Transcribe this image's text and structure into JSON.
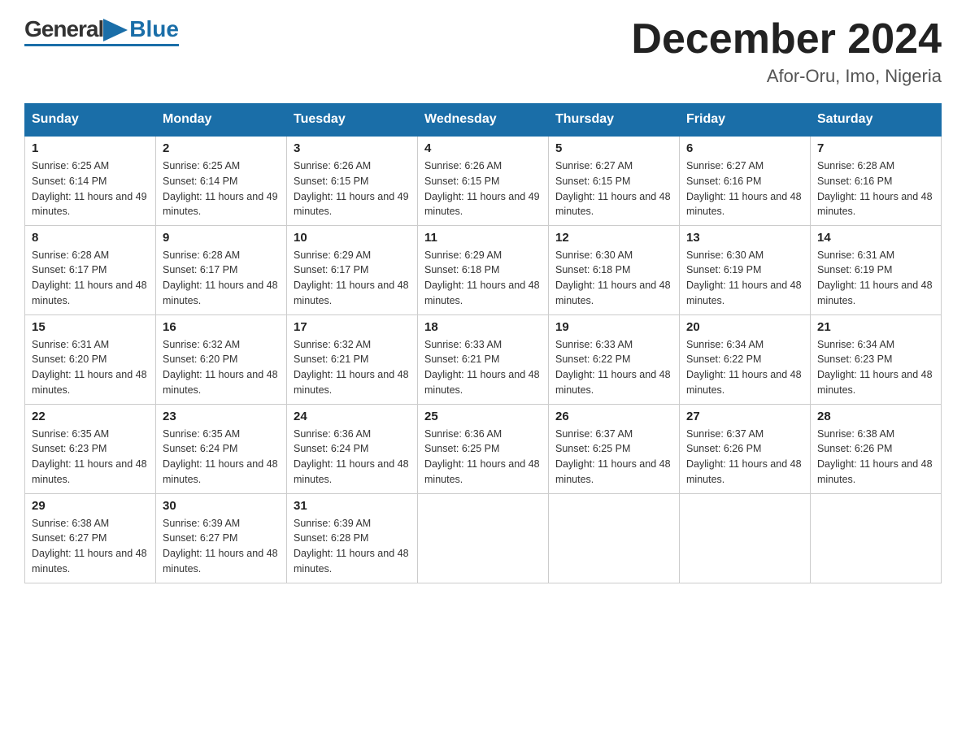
{
  "header": {
    "logo_general": "General",
    "logo_blue": "Blue",
    "month_year": "December 2024",
    "location": "Afor-Oru, Imo, Nigeria"
  },
  "weekdays": [
    "Sunday",
    "Monday",
    "Tuesday",
    "Wednesday",
    "Thursday",
    "Friday",
    "Saturday"
  ],
  "weeks": [
    [
      {
        "day": "1",
        "sunrise": "6:25 AM",
        "sunset": "6:14 PM",
        "daylight": "11 hours and 49 minutes."
      },
      {
        "day": "2",
        "sunrise": "6:25 AM",
        "sunset": "6:14 PM",
        "daylight": "11 hours and 49 minutes."
      },
      {
        "day": "3",
        "sunrise": "6:26 AM",
        "sunset": "6:15 PM",
        "daylight": "11 hours and 49 minutes."
      },
      {
        "day": "4",
        "sunrise": "6:26 AM",
        "sunset": "6:15 PM",
        "daylight": "11 hours and 49 minutes."
      },
      {
        "day": "5",
        "sunrise": "6:27 AM",
        "sunset": "6:15 PM",
        "daylight": "11 hours and 48 minutes."
      },
      {
        "day": "6",
        "sunrise": "6:27 AM",
        "sunset": "6:16 PM",
        "daylight": "11 hours and 48 minutes."
      },
      {
        "day": "7",
        "sunrise": "6:28 AM",
        "sunset": "6:16 PM",
        "daylight": "11 hours and 48 minutes."
      }
    ],
    [
      {
        "day": "8",
        "sunrise": "6:28 AM",
        "sunset": "6:17 PM",
        "daylight": "11 hours and 48 minutes."
      },
      {
        "day": "9",
        "sunrise": "6:28 AM",
        "sunset": "6:17 PM",
        "daylight": "11 hours and 48 minutes."
      },
      {
        "day": "10",
        "sunrise": "6:29 AM",
        "sunset": "6:17 PM",
        "daylight": "11 hours and 48 minutes."
      },
      {
        "day": "11",
        "sunrise": "6:29 AM",
        "sunset": "6:18 PM",
        "daylight": "11 hours and 48 minutes."
      },
      {
        "day": "12",
        "sunrise": "6:30 AM",
        "sunset": "6:18 PM",
        "daylight": "11 hours and 48 minutes."
      },
      {
        "day": "13",
        "sunrise": "6:30 AM",
        "sunset": "6:19 PM",
        "daylight": "11 hours and 48 minutes."
      },
      {
        "day": "14",
        "sunrise": "6:31 AM",
        "sunset": "6:19 PM",
        "daylight": "11 hours and 48 minutes."
      }
    ],
    [
      {
        "day": "15",
        "sunrise": "6:31 AM",
        "sunset": "6:20 PM",
        "daylight": "11 hours and 48 minutes."
      },
      {
        "day": "16",
        "sunrise": "6:32 AM",
        "sunset": "6:20 PM",
        "daylight": "11 hours and 48 minutes."
      },
      {
        "day": "17",
        "sunrise": "6:32 AM",
        "sunset": "6:21 PM",
        "daylight": "11 hours and 48 minutes."
      },
      {
        "day": "18",
        "sunrise": "6:33 AM",
        "sunset": "6:21 PM",
        "daylight": "11 hours and 48 minutes."
      },
      {
        "day": "19",
        "sunrise": "6:33 AM",
        "sunset": "6:22 PM",
        "daylight": "11 hours and 48 minutes."
      },
      {
        "day": "20",
        "sunrise": "6:34 AM",
        "sunset": "6:22 PM",
        "daylight": "11 hours and 48 minutes."
      },
      {
        "day": "21",
        "sunrise": "6:34 AM",
        "sunset": "6:23 PM",
        "daylight": "11 hours and 48 minutes."
      }
    ],
    [
      {
        "day": "22",
        "sunrise": "6:35 AM",
        "sunset": "6:23 PM",
        "daylight": "11 hours and 48 minutes."
      },
      {
        "day": "23",
        "sunrise": "6:35 AM",
        "sunset": "6:24 PM",
        "daylight": "11 hours and 48 minutes."
      },
      {
        "day": "24",
        "sunrise": "6:36 AM",
        "sunset": "6:24 PM",
        "daylight": "11 hours and 48 minutes."
      },
      {
        "day": "25",
        "sunrise": "6:36 AM",
        "sunset": "6:25 PM",
        "daylight": "11 hours and 48 minutes."
      },
      {
        "day": "26",
        "sunrise": "6:37 AM",
        "sunset": "6:25 PM",
        "daylight": "11 hours and 48 minutes."
      },
      {
        "day": "27",
        "sunrise": "6:37 AM",
        "sunset": "6:26 PM",
        "daylight": "11 hours and 48 minutes."
      },
      {
        "day": "28",
        "sunrise": "6:38 AM",
        "sunset": "6:26 PM",
        "daylight": "11 hours and 48 minutes."
      }
    ],
    [
      {
        "day": "29",
        "sunrise": "6:38 AM",
        "sunset": "6:27 PM",
        "daylight": "11 hours and 48 minutes."
      },
      {
        "day": "30",
        "sunrise": "6:39 AM",
        "sunset": "6:27 PM",
        "daylight": "11 hours and 48 minutes."
      },
      {
        "day": "31",
        "sunrise": "6:39 AM",
        "sunset": "6:28 PM",
        "daylight": "11 hours and 48 minutes."
      },
      null,
      null,
      null,
      null
    ]
  ]
}
